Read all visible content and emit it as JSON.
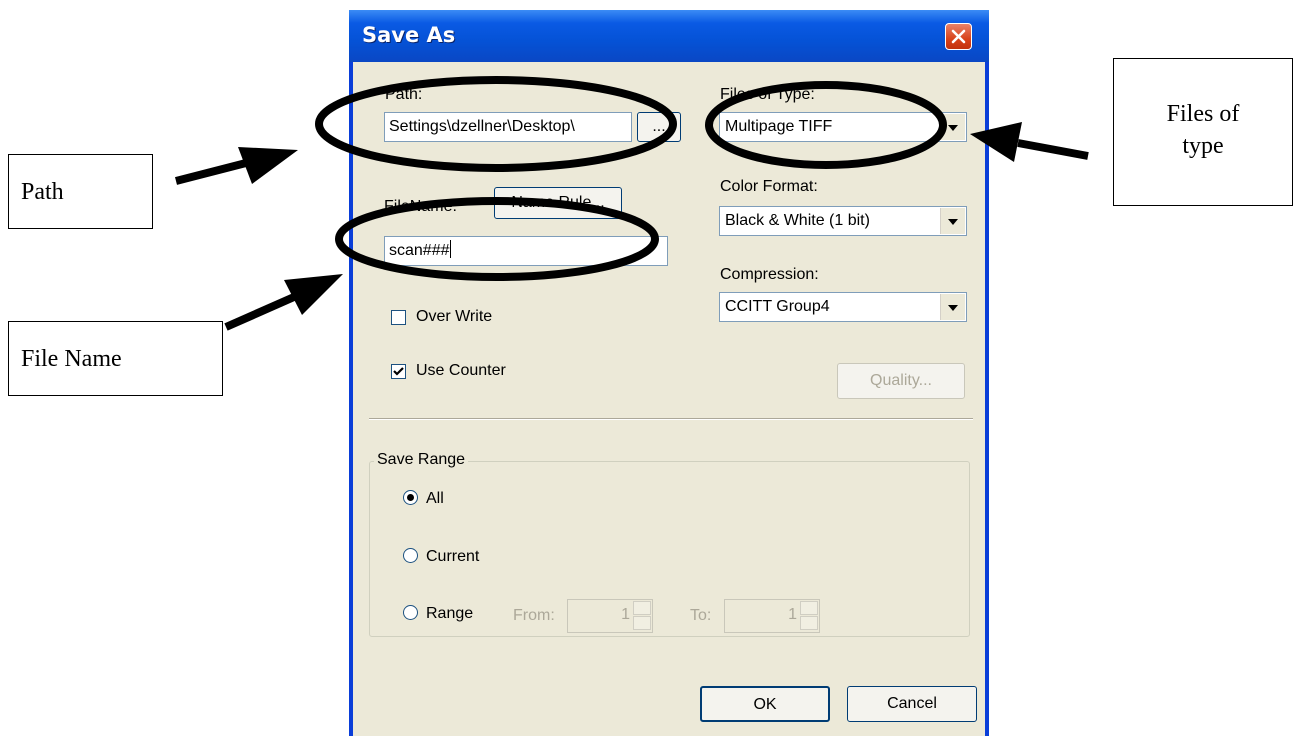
{
  "callouts": {
    "path": "Path",
    "files_of_type_line1": "Files of",
    "files_of_type_line2": "type",
    "file_name": "File Name"
  },
  "dialog": {
    "title": "Save As",
    "path_label": "Path:",
    "path_value": "Settings\\dzellner\\Desktop\\",
    "browse_label": "...",
    "filename_label": "FileName:",
    "name_rule_label": "Name Rule...",
    "filename_value": "scan###",
    "overwrite_label": "Over Write",
    "use_counter_label": "Use Counter",
    "files_of_type_label": "Files of Type:",
    "files_of_type_value": "Multipage TIFF",
    "color_format_label": "Color Format:",
    "color_format_value": "Black & White (1 bit)",
    "compression_label": "Compression:",
    "compression_value": "CCITT Group4",
    "quality_label": "Quality...",
    "save_range_label": "Save Range",
    "all_label": "All",
    "current_label": "Current",
    "range_label": "Range",
    "from_label": "From:",
    "from_value": "1",
    "to_label": "To:",
    "to_value": "1",
    "ok_label": "OK",
    "cancel_label": "Cancel"
  },
  "state": {
    "overwrite_checked": false,
    "use_counter_checked": true,
    "selected_range": "All"
  },
  "colors": {
    "titlebar": "#0552d6",
    "dialog_face": "#ece9d8",
    "close_button": "#d9431a"
  }
}
